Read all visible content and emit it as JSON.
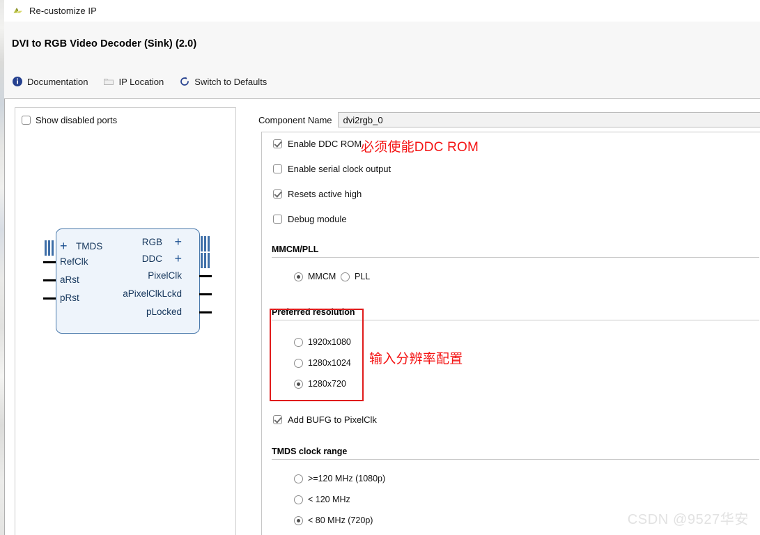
{
  "window": {
    "title": "Re-customize IP",
    "icon": "vivado-logo-icon"
  },
  "header": {
    "ip_title": "DVI to RGB Video Decoder (Sink) (2.0)",
    "toolbar": [
      {
        "label": "Documentation",
        "icon": "info-icon"
      },
      {
        "label": "IP Location",
        "icon": "folder-icon"
      },
      {
        "label": "Switch to Defaults",
        "icon": "refresh-icon"
      }
    ]
  },
  "left_panel": {
    "show_disabled_ports": {
      "label": "Show disabled ports",
      "checked": false
    },
    "symbol": {
      "inputs": [
        "TMDS",
        "RefClk",
        "aRst",
        "pRst"
      ],
      "outputs": [
        "RGB",
        "DDC",
        "PixelClk",
        "aPixelClkLckd",
        "pLocked"
      ]
    }
  },
  "right_panel": {
    "component_name_label": "Component Name",
    "component_name_value": "dvi2rgb_0",
    "checkboxes": [
      {
        "label": "Enable DDC ROM",
        "checked": true
      },
      {
        "label": "Enable serial clock output",
        "checked": false
      },
      {
        "label": "Resets active high",
        "checked": true
      },
      {
        "label": "Debug module",
        "checked": false
      }
    ],
    "mmcm_section": {
      "title": "MMCM/PLL",
      "options": [
        {
          "label": "MMCM",
          "selected": true
        },
        {
          "label": "PLL",
          "selected": false
        }
      ]
    },
    "resolution_section": {
      "title": "Preferred resolution",
      "options": [
        {
          "label": "1920x1080",
          "selected": false
        },
        {
          "label": "1280x1024",
          "selected": false
        },
        {
          "label": "1280x720",
          "selected": true
        }
      ]
    },
    "bufg_checkbox": {
      "label": "Add BUFG to PixelClk",
      "checked": true
    },
    "tmds_section": {
      "title": "TMDS clock range",
      "options": [
        {
          "label": ">=120 MHz (1080p)",
          "selected": false
        },
        {
          "label": "< 120 MHz",
          "selected": false
        },
        {
          "label": "< 80 MHz (720p)",
          "selected": true
        }
      ]
    }
  },
  "annotations": [
    {
      "text": "必须使能DDC ROM",
      "color": "#f41414"
    },
    {
      "text": "输入分辨率配置",
      "color": "#f41414"
    }
  ],
  "watermark": {
    "text": "CSDN @9527华安"
  },
  "colors": {
    "annotation_red": "#f41414",
    "box_red": "#e01b1b",
    "symbol_border": "#4a79ab",
    "symbol_fill": "#eef4fb",
    "toolbar_blue": "#26418f"
  }
}
